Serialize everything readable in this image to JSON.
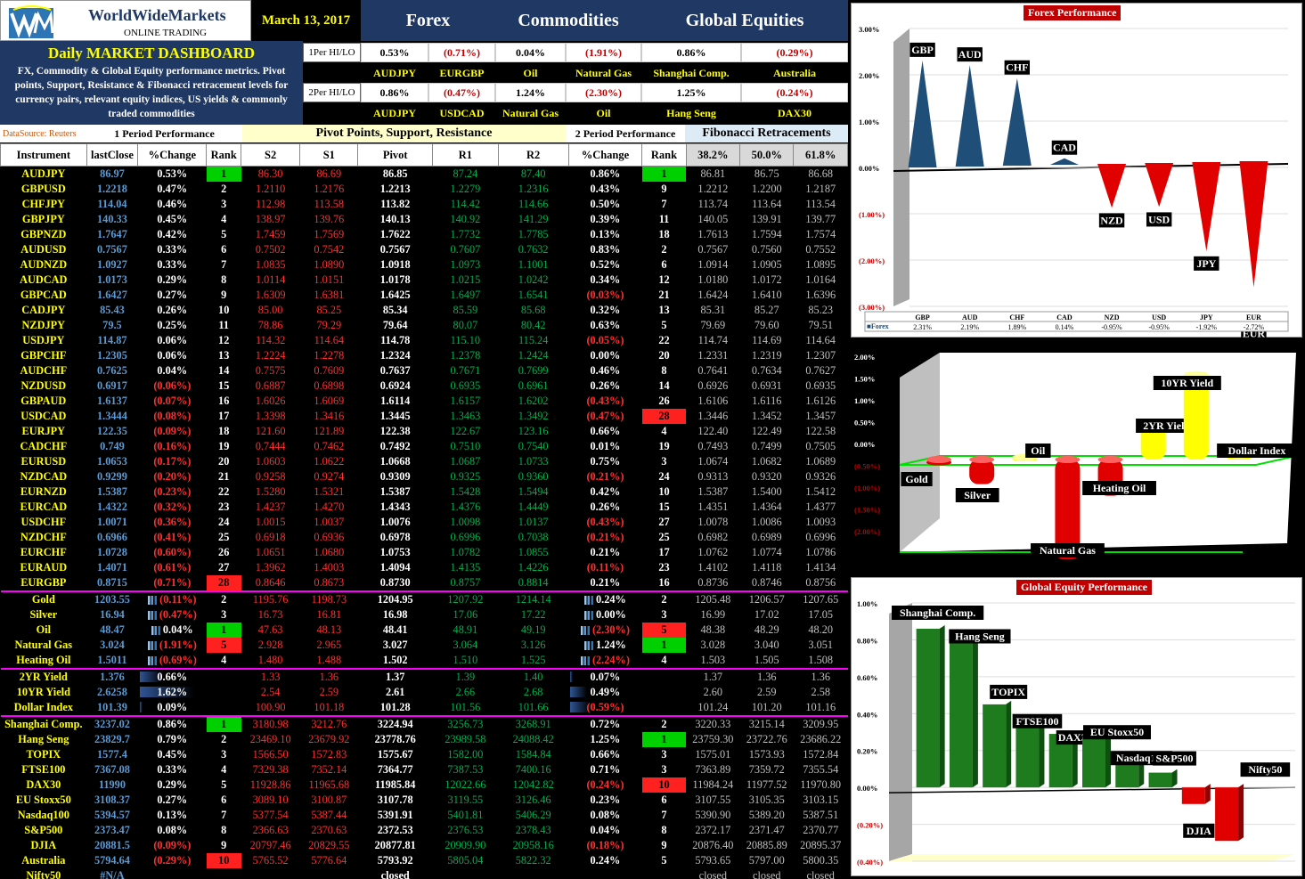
{
  "header": {
    "logo_name": "WorldWideMarkets",
    "logo_tagline": "ONLINE TRADING",
    "date": "March 13, 2017",
    "sections": [
      "Forex",
      "Commodities",
      "Global Equities"
    ]
  },
  "dashboard": {
    "title": "Daily MARKET DASHBOARD",
    "description": "FX, Commodity & Global Equity performance metrics. Pivot points, Support, Resistance & Fibonacci retracement levels for currency pairs, relevant equity indices, US yields & commonly traded commodities",
    "datasource": "DataSource: Reuters"
  },
  "period1": {
    "label": "1Per HI/LO",
    "values": [
      "0.53%",
      "(0.71%)",
      "0.04%",
      "(1.91%)",
      "0.86%",
      "(0.29%)"
    ],
    "names": [
      "AUDJPY",
      "EURGBP",
      "Oil",
      "Natural Gas",
      "Shanghai Comp.",
      "Australia"
    ]
  },
  "period2": {
    "label": "2Per HI/LO",
    "values": [
      "0.86%",
      "(0.47%)",
      "1.24%",
      "(2.30%)",
      "1.25%",
      "(0.24%)"
    ],
    "names": [
      "AUDJPY",
      "USDCAD",
      "Natural Gas",
      "Oil",
      "Hang Seng",
      "DAX30"
    ]
  },
  "section_headers": {
    "p1": "1 Period Performance",
    "pivot": "Pivot Points, Support, Resistance",
    "p2": "2 Period Performance",
    "fib": "Fibonacci Retracements"
  },
  "columns": [
    "Instrument",
    "lastClose",
    "%Change",
    "Rank",
    "S2",
    "S1",
    "Pivot",
    "R1",
    "R2",
    "%Change",
    "Rank",
    "38.2%",
    "50.0%",
    "61.8%"
  ],
  "rows": [
    [
      "AUDJPY",
      "86.97",
      "0.53%",
      "1",
      "86.30",
      "86.69",
      "86.85",
      "87.24",
      "87.40",
      "0.86%",
      "1",
      "86.81",
      "86.75",
      "86.68"
    ],
    [
      "GBPUSD",
      "1.2218",
      "0.47%",
      "2",
      "1.2110",
      "1.2176",
      "1.2213",
      "1.2279",
      "1.2316",
      "0.43%",
      "9",
      "1.2212",
      "1.2200",
      "1.2187"
    ],
    [
      "CHFJPY",
      "114.04",
      "0.46%",
      "3",
      "112.98",
      "113.58",
      "113.82",
      "114.42",
      "114.66",
      "0.50%",
      "7",
      "113.74",
      "113.64",
      "113.54"
    ],
    [
      "GBPJPY",
      "140.33",
      "0.45%",
      "4",
      "138.97",
      "139.76",
      "140.13",
      "140.92",
      "141.29",
      "0.39%",
      "11",
      "140.05",
      "139.91",
      "139.77"
    ],
    [
      "GBPNZD",
      "1.7647",
      "0.42%",
      "5",
      "1.7459",
      "1.7569",
      "1.7622",
      "1.7732",
      "1.7785",
      "0.13%",
      "18",
      "1.7613",
      "1.7594",
      "1.7574"
    ],
    [
      "AUDUSD",
      "0.7567",
      "0.33%",
      "6",
      "0.7502",
      "0.7542",
      "0.7567",
      "0.7607",
      "0.7632",
      "0.83%",
      "2",
      "0.7567",
      "0.7560",
      "0.7552"
    ],
    [
      "AUDNZD",
      "1.0927",
      "0.33%",
      "7",
      "1.0835",
      "1.0890",
      "1.0918",
      "1.0973",
      "1.1001",
      "0.52%",
      "6",
      "1.0914",
      "1.0905",
      "1.0895"
    ],
    [
      "AUDCAD",
      "1.0173",
      "0.29%",
      "8",
      "1.0114",
      "1.0151",
      "1.0178",
      "1.0215",
      "1.0242",
      "0.34%",
      "12",
      "1.0180",
      "1.0172",
      "1.0164"
    ],
    [
      "GBPCAD",
      "1.6427",
      "0.27%",
      "9",
      "1.6309",
      "1.6381",
      "1.6425",
      "1.6497",
      "1.6541",
      "(0.03%)",
      "21",
      "1.6424",
      "1.6410",
      "1.6396"
    ],
    [
      "CADJPY",
      "85.43",
      "0.26%",
      "10",
      "85.00",
      "85.25",
      "85.34",
      "85.59",
      "85.68",
      "0.32%",
      "13",
      "85.31",
      "85.27",
      "85.23"
    ],
    [
      "NZDJPY",
      "79.5",
      "0.25%",
      "11",
      "78.86",
      "79.29",
      "79.64",
      "80.07",
      "80.42",
      "0.63%",
      "5",
      "79.69",
      "79.60",
      "79.51"
    ],
    [
      "USDJPY",
      "114.87",
      "0.06%",
      "12",
      "114.32",
      "114.64",
      "114.78",
      "115.10",
      "115.24",
      "(0.05%)",
      "22",
      "114.74",
      "114.69",
      "114.64"
    ],
    [
      "GBPCHF",
      "1.2305",
      "0.06%",
      "13",
      "1.2224",
      "1.2278",
      "1.2324",
      "1.2378",
      "1.2424",
      "0.00%",
      "20",
      "1.2331",
      "1.2319",
      "1.2307"
    ],
    [
      "AUDCHF",
      "0.7625",
      "0.04%",
      "14",
      "0.7575",
      "0.7609",
      "0.7637",
      "0.7671",
      "0.7699",
      "0.46%",
      "8",
      "0.7641",
      "0.7634",
      "0.7627"
    ],
    [
      "NZDUSD",
      "0.6917",
      "(0.06%)",
      "15",
      "0.6887",
      "0.6898",
      "0.6924",
      "0.6935",
      "0.6961",
      "0.26%",
      "14",
      "0.6926",
      "0.6931",
      "0.6935"
    ],
    [
      "GBPAUD",
      "1.6137",
      "(0.07%)",
      "16",
      "1.6026",
      "1.6069",
      "1.6114",
      "1.6157",
      "1.6202",
      "(0.43%)",
      "26",
      "1.6106",
      "1.6116",
      "1.6126"
    ],
    [
      "USDCAD",
      "1.3444",
      "(0.08%)",
      "17",
      "1.3398",
      "1.3416",
      "1.3445",
      "1.3463",
      "1.3492",
      "(0.47%)",
      "28",
      "1.3446",
      "1.3452",
      "1.3457"
    ],
    [
      "EURJPY",
      "122.35",
      "(0.09%)",
      "18",
      "121.60",
      "121.89",
      "122.38",
      "122.67",
      "123.16",
      "0.66%",
      "4",
      "122.40",
      "122.49",
      "122.58"
    ],
    [
      "CADCHF",
      "0.749",
      "(0.16%)",
      "19",
      "0.7444",
      "0.7462",
      "0.7492",
      "0.7510",
      "0.7540",
      "0.01%",
      "19",
      "0.7493",
      "0.7499",
      "0.7505"
    ],
    [
      "EURUSD",
      "1.0653",
      "(0.17%)",
      "20",
      "1.0603",
      "1.0622",
      "1.0668",
      "1.0687",
      "1.0733",
      "0.75%",
      "3",
      "1.0674",
      "1.0682",
      "1.0689"
    ],
    [
      "NZDCAD",
      "0.9299",
      "(0.20%)",
      "21",
      "0.9258",
      "0.9274",
      "0.9309",
      "0.9325",
      "0.9360",
      "(0.21%)",
      "24",
      "0.9313",
      "0.9320",
      "0.9326"
    ],
    [
      "EURNZD",
      "1.5387",
      "(0.23%)",
      "22",
      "1.5280",
      "1.5321",
      "1.5387",
      "1.5428",
      "1.5494",
      "0.42%",
      "10",
      "1.5387",
      "1.5400",
      "1.5412"
    ],
    [
      "EURCAD",
      "1.4322",
      "(0.32%)",
      "23",
      "1.4237",
      "1.4270",
      "1.4343",
      "1.4376",
      "1.4449",
      "0.26%",
      "15",
      "1.4351",
      "1.4364",
      "1.4377"
    ],
    [
      "USDCHF",
      "1.0071",
      "(0.36%)",
      "24",
      "1.0015",
      "1.0037",
      "1.0076",
      "1.0098",
      "1.0137",
      "(0.43%)",
      "27",
      "1.0078",
      "1.0086",
      "1.0093"
    ],
    [
      "NZDCHF",
      "0.6966",
      "(0.41%)",
      "25",
      "0.6918",
      "0.6936",
      "0.6978",
      "0.6996",
      "0.7038",
      "(0.21%)",
      "25",
      "0.6982",
      "0.6989",
      "0.6996"
    ],
    [
      "EURCHF",
      "1.0728",
      "(0.60%)",
      "26",
      "1.0651",
      "1.0680",
      "1.0753",
      "1.0782",
      "1.0855",
      "0.21%",
      "17",
      "1.0762",
      "1.0774",
      "1.0786"
    ],
    [
      "EURAUD",
      "1.4071",
      "(0.61%)",
      "27",
      "1.3962",
      "1.4003",
      "1.4094",
      "1.4135",
      "1.4226",
      "(0.11%)",
      "23",
      "1.4102",
      "1.4118",
      "1.4134"
    ],
    [
      "EURGBP",
      "0.8715",
      "(0.71%)",
      "28",
      "0.8646",
      "0.8673",
      "0.8730",
      "0.8757",
      "0.8814",
      "0.21%",
      "16",
      "0.8736",
      "0.8746",
      "0.8756"
    ],
    [
      "Gold",
      "1203.55",
      "(0.11%)",
      "2",
      "1195.76",
      "1198.73",
      "1204.95",
      "1207.92",
      "1214.14",
      "0.24%",
      "2",
      "1205.48",
      "1206.57",
      "1207.65"
    ],
    [
      "Silver",
      "16.94",
      "(0.47%)",
      "3",
      "16.73",
      "16.81",
      "16.98",
      "17.06",
      "17.22",
      "0.00%",
      "3",
      "16.99",
      "17.02",
      "17.05"
    ],
    [
      "Oil",
      "48.47",
      "0.04%",
      "1",
      "47.63",
      "48.13",
      "48.41",
      "48.91",
      "49.19",
      "(2.30%)",
      "5",
      "48.38",
      "48.29",
      "48.20"
    ],
    [
      "Natural Gas",
      "3.024",
      "(1.91%)",
      "5",
      "2.928",
      "2.965",
      "3.027",
      "3.064",
      "3.126",
      "1.24%",
      "1",
      "3.028",
      "3.040",
      "3.051"
    ],
    [
      "Heating Oil",
      "1.5011",
      "(0.69%)",
      "4",
      "1.480",
      "1.488",
      "1.502",
      "1.510",
      "1.525",
      "(2.24%)",
      "4",
      "1.503",
      "1.505",
      "1.508"
    ],
    [
      "2YR Yield",
      "1.376",
      "0.66%",
      "",
      "1.33",
      "1.36",
      "1.37",
      "1.39",
      "1.40",
      "0.07%",
      "",
      "1.37",
      "1.36",
      "1.36"
    ],
    [
      "10YR Yield",
      "2.6258",
      "1.62%",
      "",
      "2.54",
      "2.59",
      "2.61",
      "2.66",
      "2.68",
      "0.49%",
      "",
      "2.60",
      "2.59",
      "2.58"
    ],
    [
      "Dollar Index",
      "101.39",
      "0.09%",
      "",
      "100.90",
      "101.18",
      "101.28",
      "101.56",
      "101.66",
      "(0.59%)",
      "",
      "101.24",
      "101.20",
      "101.16"
    ],
    [
      "Shanghai Comp.",
      "3237.02",
      "0.86%",
      "1",
      "3180.98",
      "3212.76",
      "3224.94",
      "3256.73",
      "3268.91",
      "0.72%",
      "2",
      "3220.33",
      "3215.14",
      "3209.95"
    ],
    [
      "Hang Seng",
      "23829.7",
      "0.79%",
      "2",
      "23469.10",
      "23679.92",
      "23778.76",
      "23989.58",
      "24088.42",
      "1.25%",
      "1",
      "23759.30",
      "23722.76",
      "23686.22"
    ],
    [
      "TOPIX",
      "1577.4",
      "0.45%",
      "3",
      "1566.50",
      "1572.83",
      "1575.67",
      "1582.00",
      "1584.84",
      "0.66%",
      "3",
      "1575.01",
      "1573.93",
      "1572.84"
    ],
    [
      "FTSE100",
      "7367.08",
      "0.33%",
      "4",
      "7329.38",
      "7352.14",
      "7364.77",
      "7387.53",
      "7400.16",
      "0.71%",
      "3",
      "7363.89",
      "7359.72",
      "7355.54"
    ],
    [
      "DAX30",
      "11990",
      "0.29%",
      "5",
      "11928.86",
      "11965.68",
      "11985.84",
      "12022.66",
      "12042.82",
      "(0.24%)",
      "10",
      "11984.24",
      "11977.52",
      "11970.80"
    ],
    [
      "EU Stoxx50",
      "3108.37",
      "0.27%",
      "6",
      "3089.10",
      "3100.87",
      "3107.78",
      "3119.55",
      "3126.46",
      "0.23%",
      "6",
      "3107.55",
      "3105.35",
      "3103.15"
    ],
    [
      "Nasdaq100",
      "5394.57",
      "0.13%",
      "7",
      "5377.54",
      "5387.44",
      "5391.91",
      "5401.81",
      "5406.29",
      "0.08%",
      "7",
      "5390.90",
      "5389.20",
      "5387.51"
    ],
    [
      "S&P500",
      "2373.47",
      "0.08%",
      "8",
      "2366.63",
      "2370.63",
      "2372.53",
      "2376.53",
      "2378.43",
      "0.04%",
      "8",
      "2372.17",
      "2371.47",
      "2370.77"
    ],
    [
      "DJIA",
      "20881.5",
      "(0.09%)",
      "9",
      "20797.46",
      "20829.55",
      "20877.81",
      "20909.90",
      "20958.16",
      "(0.18%)",
      "9",
      "20876.40",
      "20885.89",
      "20895.37"
    ],
    [
      "Australia",
      "5794.64",
      "(0.29%)",
      "10",
      "5765.52",
      "5776.64",
      "5793.92",
      "5805.04",
      "5822.32",
      "0.24%",
      "5",
      "5793.65",
      "5797.00",
      "5800.35"
    ],
    [
      "Nifty50",
      "#N/A",
      "",
      "",
      "",
      "",
      "closed",
      "",
      "",
      "",
      "",
      "closed",
      "closed",
      "closed"
    ]
  ],
  "chart_data": [
    {
      "type": "bar",
      "title": "Forex Performance",
      "categories": [
        "GBP",
        "AUD",
        "CHF",
        "CAD",
        "NZD",
        "USD",
        "JPY",
        "EUR"
      ],
      "series": [
        {
          "name": "Forex",
          "values": [
            2.31,
            2.19,
            1.89,
            0.14,
            -0.95,
            -0.95,
            -1.92,
            -2.72
          ],
          "labels": [
            "2.31%",
            "2.19%",
            "1.89%",
            "0.14%",
            "-0.95%",
            "-0.95%",
            "-1.92%",
            "-2.72%"
          ]
        }
      ],
      "ylim": [
        -3,
        3
      ],
      "yticks": [
        "3.00%",
        "2.00%",
        "1.00%",
        "0.00%",
        "(1.00%)",
        "(2.00%)",
        "(3.00%)"
      ]
    },
    {
      "type": "bar",
      "title": "",
      "categories": [
        "Gold",
        "Silver",
        "Oil",
        "Natural Gas",
        "Heating Oil",
        "2YR Yield",
        "10YR Yield",
        "Dollar Index"
      ],
      "values": [
        -0.11,
        -0.47,
        0.04,
        -1.91,
        -0.69,
        0.66,
        1.62,
        0.09
      ],
      "ylim": [
        -2,
        2
      ],
      "yticks": [
        "2.00%",
        "1.50%",
        "1.00%",
        "0.50%",
        "0.00%",
        "(0.50%)",
        "(1.00%)",
        "(1.50%)",
        "(2.00%)"
      ]
    },
    {
      "type": "bar",
      "title": "Global Equity Performance",
      "categories": [
        "Shanghai Comp.",
        "Hang Seng",
        "TOPIX",
        "FTSE100",
        "DAX30",
        "EU Stoxx50",
        "Nasdaq100",
        "S&P500",
        "DJIA",
        "Australia",
        "Nifty50"
      ],
      "values": [
        0.86,
        0.79,
        0.45,
        0.33,
        0.29,
        0.27,
        0.13,
        0.08,
        -0.09,
        -0.29,
        0
      ],
      "ylim": [
        -0.4,
        1.0
      ],
      "yticks": [
        "1.00%",
        "0.80%",
        "0.60%",
        "0.40%",
        "0.20%",
        "0.00%",
        "(0.20%)",
        "(0.40%)"
      ]
    }
  ],
  "colors": {
    "navy": "#1f3864",
    "green_rank": "#00d000",
    "red_rank": "#ff2020",
    "name_yellow": "#ffff00",
    "value_blue": "#5b9bd5",
    "bar_blue": "#1f4e79",
    "bar_red": "#e00000",
    "bar_green": "#1e7b1e",
    "bar_yellow": "#ffff00"
  }
}
